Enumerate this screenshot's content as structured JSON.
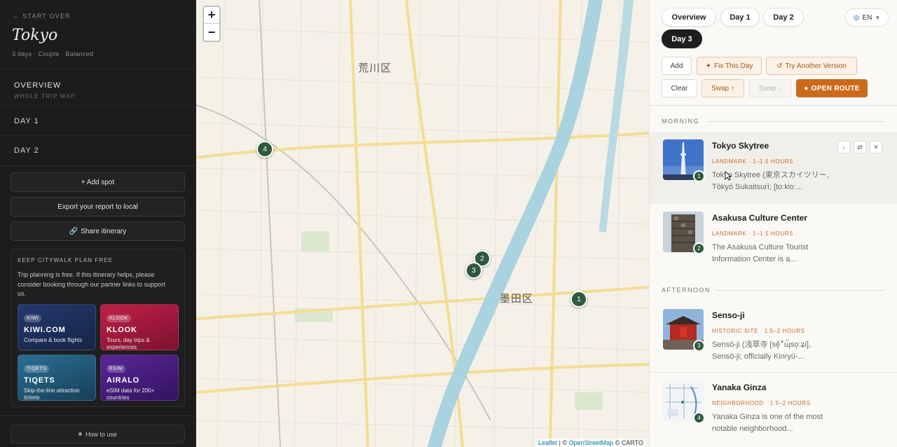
{
  "sidebar": {
    "start_over": "START OVER",
    "city": "Tokyo",
    "meta": "3 days · Couple · Balanced",
    "overview": {
      "label": "OVERVIEW",
      "sub": "WHOLE TRIP MAP"
    },
    "days": [
      "DAY 1",
      "DAY 2"
    ],
    "add_spot": "+ Add spot",
    "export": "Export your report to local",
    "share": "Share itinerary",
    "promo": {
      "title": "KEEP CITYWALK PLAN FREE",
      "text": "Trip planning is free. If this itinerary helps, please consider booking through our partner links to support us.",
      "cards": [
        {
          "tag": "KIWI",
          "name": "KIWI.COM",
          "desc": "Compare & book flights",
          "color": "#1e2f5c"
        },
        {
          "tag": "KLOOK",
          "name": "KLOOK",
          "desc": "Tours, day trips & experiences",
          "color": "#a3173a"
        },
        {
          "tag": "TIQETS",
          "name": "TIQETS",
          "desc": "Skip-the-line attraction tickets",
          "color": "#1e5a7a"
        },
        {
          "tag": "ESIM",
          "name": "AIRALO",
          "desc": "eSIM data for 200+ countries",
          "color": "#4a1d7a"
        }
      ]
    },
    "how_to": "How to use"
  },
  "map": {
    "zoom_in": "+",
    "zoom_out": "−",
    "labels": {
      "arakawa": "荒川区",
      "sumida": "墨田区"
    },
    "markers": [
      "1",
      "2",
      "3",
      "4"
    ],
    "attribution": {
      "leaflet": "Leaflet",
      "sep": " | © ",
      "osm": "OpenStreetMap",
      "carto": " © CARTO"
    }
  },
  "panel": {
    "tabs": [
      "Overview",
      "Day 1",
      "Day 2",
      "Day 3"
    ],
    "active_tab": "Day 3",
    "lang": "EN",
    "actions": {
      "add": "Add",
      "fix": "Fix This Day",
      "try_another": "Try Another Version",
      "clear": "Clear",
      "swap_up": "Swap ↑",
      "swap_down": "Swap ↓",
      "open_route": "OPEN ROUTE"
    },
    "sections": {
      "morning": "MORNING",
      "afternoon": "AFTERNOON"
    },
    "spots": [
      {
        "num": "1",
        "name": "Tokyo Skytree",
        "category": "LANDMARK · 1–1.5 HOURS",
        "desc": "Tokyo Skytree (東京スカイツリー, Tōkyō Sukaitsurī; [toːkʲoː..."
      },
      {
        "num": "2",
        "name": "Asakusa Culture Center",
        "category": "LANDMARK · 1–1.5 HOURS",
        "desc": "The Asakusa Culture Tourist Information Center is a..."
      },
      {
        "num": "3",
        "name": "Senso-ji",
        "category": "HISTORIC SITE · 1.5–2 HOURS",
        "desc": "Sensō-ji (浅草寺 [sẽ̞ꜜɰ̃so̞ːʑi], Sensō-ji; officially Kinryū-..."
      },
      {
        "num": "4",
        "name": "Yanaka Ginza",
        "category": "NEIGHBORHOOD · 1.5–2 HOURS",
        "desc": "Yanaka Ginza is one of the most notable neighborhood..."
      }
    ]
  }
}
